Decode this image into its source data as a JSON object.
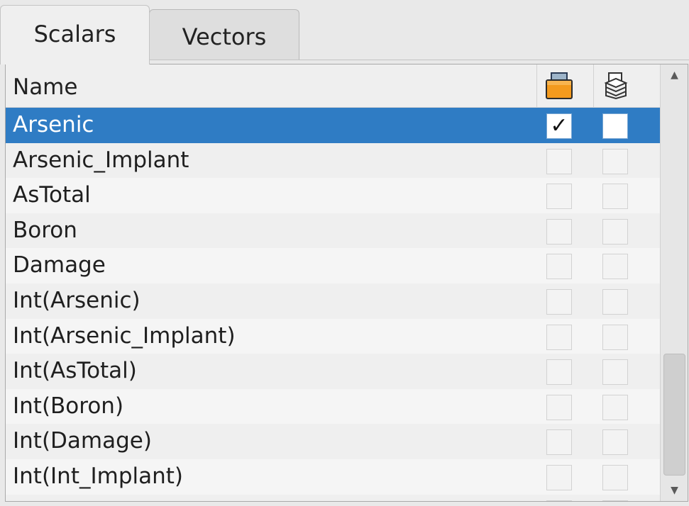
{
  "tabs": [
    {
      "label": "Scalars",
      "active": true
    },
    {
      "label": "Vectors",
      "active": false
    }
  ],
  "table": {
    "header": {
      "name": "Name",
      "col1_icon": "orange-folder-icon",
      "col2_icon": "layers-icon"
    },
    "rows": [
      {
        "name": "Arsenic",
        "col1": true,
        "col2": false,
        "selected": true
      },
      {
        "name": "Arsenic_Implant",
        "col1": false,
        "col2": false
      },
      {
        "name": "AsTotal",
        "col1": false,
        "col2": false
      },
      {
        "name": "Boron",
        "col1": false,
        "col2": false
      },
      {
        "name": "Damage",
        "col1": false,
        "col2": false
      },
      {
        "name": "Int(Arsenic)",
        "col1": false,
        "col2": false
      },
      {
        "name": "Int(Arsenic_Implant)",
        "col1": false,
        "col2": false
      },
      {
        "name": "Int(AsTotal)",
        "col1": false,
        "col2": false
      },
      {
        "name": "Int(Boron)",
        "col1": false,
        "col2": false
      },
      {
        "name": "Int(Damage)",
        "col1": false,
        "col2": false
      },
      {
        "name": "Int(Int_Implant)",
        "col1": false,
        "col2": false
      }
    ]
  },
  "scrollbar": {
    "up_icon": "scroll-up-arrow-icon",
    "down_icon": "scroll-down-arrow-icon",
    "position": 0.7
  },
  "colors": {
    "selection": "#2f7cc4",
    "folder": "#f39a1e"
  }
}
